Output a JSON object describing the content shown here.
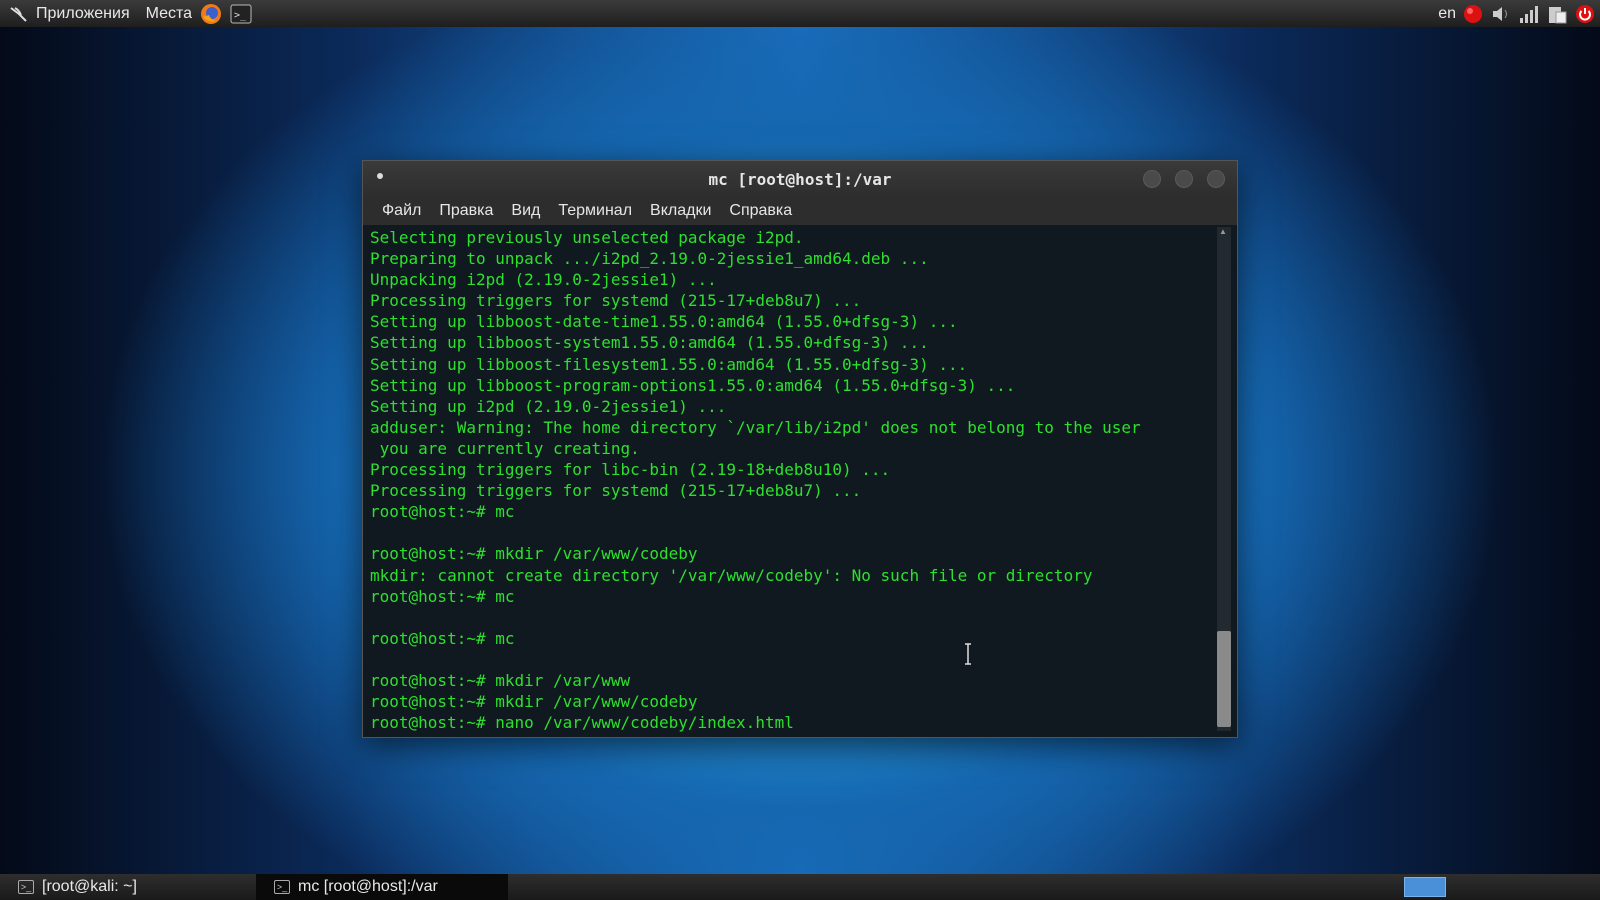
{
  "top_panel": {
    "applications_label": "Приложения",
    "places_label": "Места",
    "keyboard_layout": "en"
  },
  "window": {
    "title": "mc [root@host]:/var",
    "menu": [
      "Файл",
      "Правка",
      "Вид",
      "Терминал",
      "Вкладки",
      "Справка"
    ]
  },
  "terminal": {
    "text_color": "#2ee02e",
    "lines": [
      "Selecting previously unselected package i2pd.",
      "Preparing to unpack .../i2pd_2.19.0-2jessie1_amd64.deb ...",
      "Unpacking i2pd (2.19.0-2jessie1) ...",
      "Processing triggers for systemd (215-17+deb8u7) ...",
      "Setting up libboost-date-time1.55.0:amd64 (1.55.0+dfsg-3) ...",
      "Setting up libboost-system1.55.0:amd64 (1.55.0+dfsg-3) ...",
      "Setting up libboost-filesystem1.55.0:amd64 (1.55.0+dfsg-3) ...",
      "Setting up libboost-program-options1.55.0:amd64 (1.55.0+dfsg-3) ...",
      "Setting up i2pd (2.19.0-2jessie1) ...",
      "adduser: Warning: The home directory `/var/lib/i2pd' does not belong to the user",
      " you are currently creating.",
      "Processing triggers for libc-bin (2.19-18+deb8u10) ...",
      "Processing triggers for systemd (215-17+deb8u7) ...",
      "root@host:~# mc",
      "",
      "root@host:~# mkdir /var/www/codeby",
      "mkdir: cannot create directory '/var/www/codeby': No such file or directory",
      "root@host:~# mc",
      "",
      "root@host:~# mc",
      "",
      "root@host:~# mkdir /var/www",
      "root@host:~# mkdir /var/www/codeby",
      "root@host:~# nano /var/www/codeby/index.html"
    ]
  },
  "taskbar": {
    "tasks": [
      {
        "label": "[root@kali: ~]",
        "active": false
      },
      {
        "label": "mc [root@host]:/var",
        "active": true
      }
    ]
  }
}
